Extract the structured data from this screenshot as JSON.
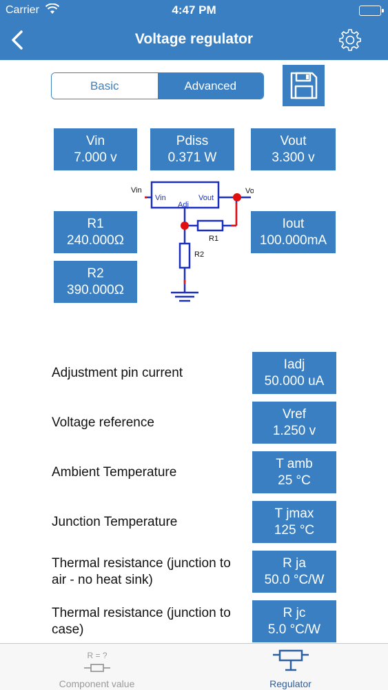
{
  "status": {
    "carrier": "Carrier",
    "time": "4:47 PM",
    "wifi_icon": "wifi-icon",
    "battery_icon": "battery-icon"
  },
  "nav": {
    "title": "Voltage regulator",
    "back_icon": "chevron-left-icon",
    "settings_icon": "gear-icon"
  },
  "segments": {
    "basic": "Basic",
    "advanced": "Advanced",
    "selected": "Advanced"
  },
  "save_icon": "floppy-disk-icon",
  "values": {
    "vin": {
      "name": "Vin",
      "value": "7.000 v"
    },
    "pdiss": {
      "name": "Pdiss",
      "value": "0.371 W"
    },
    "vout": {
      "name": "Vout",
      "value": "3.300 v"
    },
    "r1": {
      "name": "R1",
      "value": "240.000Ω"
    },
    "iout": {
      "name": "Iout",
      "value": "100.000mA"
    },
    "r2": {
      "name": "R2",
      "value": "390.000Ω"
    }
  },
  "diagram": {
    "vin": "Vin",
    "vin_pin": "Vin",
    "vout_pin": "Vout",
    "adj": "Adj",
    "vo": "Vo",
    "r1": "R1",
    "r2": "R2"
  },
  "params": [
    {
      "label": "Adjustment pin current",
      "name": "Iadj",
      "value": "50.000 uA"
    },
    {
      "label": "Voltage reference",
      "name": "Vref",
      "value": "1.250 v"
    },
    {
      "label": "Ambient Temperature",
      "name": "T amb",
      "value": "25 °C"
    },
    {
      "label": "Junction Temperature",
      "name": "T jmax",
      "value": "125 °C"
    },
    {
      "label": "Thermal resistance (junction to air - no heat sink)",
      "name": "R ja",
      "value": "50.0 °C/W"
    },
    {
      "label": "Thermal resistance (junction to case)",
      "name": "R jc",
      "value": "5.0 °C/W"
    }
  ],
  "tabs": {
    "component": {
      "label": "Component value",
      "icon_text": "R = ?"
    },
    "regulator": {
      "label": "Regulator"
    }
  },
  "colors": {
    "accent": "#3a7fc1",
    "wire": "#1a2fbf",
    "node": "#e01010",
    "tab_active": "#2a5fa0",
    "tab_inactive": "#9a9a9a"
  }
}
